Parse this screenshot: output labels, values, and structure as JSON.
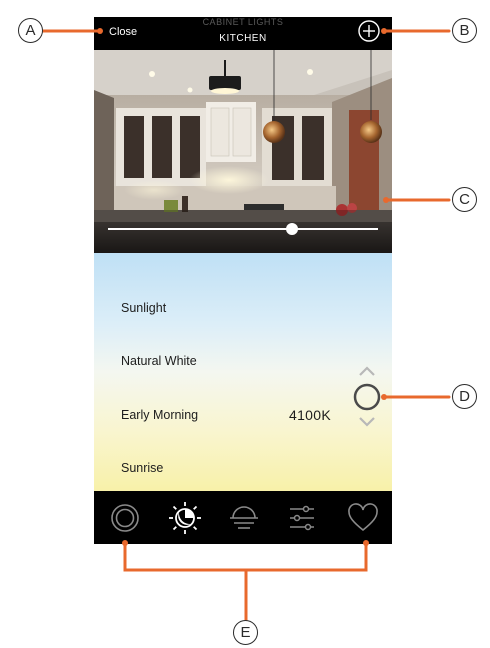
{
  "header": {
    "close_label": "Close",
    "subtitle": "CABINET LIGHTS",
    "title": "KITCHEN",
    "add_icon": "plus-circle-icon"
  },
  "brightness": {
    "level": 0.69
  },
  "scenes": {
    "items": [
      {
        "label": "Sunlight"
      },
      {
        "label": "Natural White"
      },
      {
        "label": "Early Morning"
      },
      {
        "label": "Sunrise"
      }
    ],
    "selected": "Early Morning",
    "kelvin": "4100K"
  },
  "tabbar": {
    "icons": [
      "target-circle-icon",
      "sun-moon-icon",
      "sunrise-icon",
      "sliders-icon",
      "heart-icon"
    ],
    "active_index": 1
  },
  "callouts": {
    "a": "A",
    "b": "B",
    "c": "C",
    "d": "D",
    "e": "E"
  },
  "colors": {
    "accent": "#e8692d",
    "tab_icon": "#8a8a8a",
    "tab_active": "#ffffff"
  }
}
